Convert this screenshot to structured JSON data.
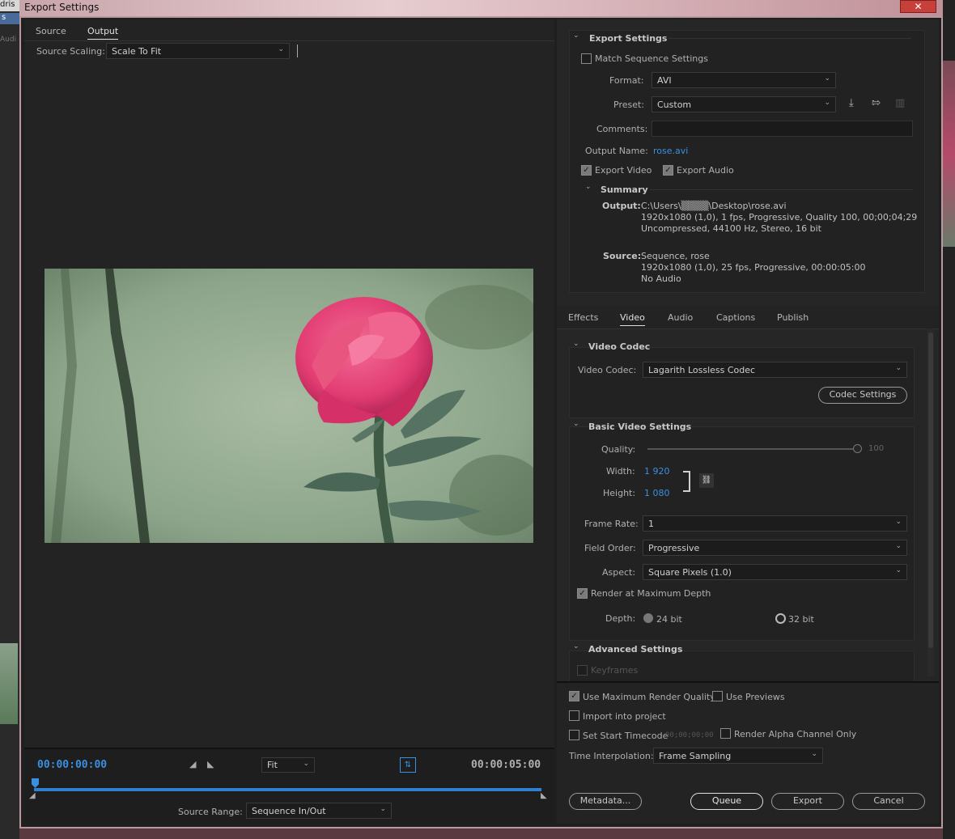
{
  "background": {
    "top_left_1": "dris",
    "top_left_2": "s",
    "side_label": "Audi"
  },
  "window": {
    "title": "Export Settings",
    "close_glyph": "✕"
  },
  "left": {
    "tabs": [
      "Source",
      "Output"
    ],
    "source_scaling_label": "Source Scaling:",
    "source_scaling_value": "Scale To Fit",
    "timecode_start": "00:00:00:00",
    "timecode_end": "00:00:05:00",
    "zoom_value": "Fit",
    "source_range_label": "Source Range:",
    "source_range_value": "Sequence In/Out"
  },
  "export_settings": {
    "header": "Export Settings",
    "match_sequence": "Match Sequence Settings",
    "format_label": "Format:",
    "format_value": "AVI",
    "preset_label": "Preset:",
    "preset_value": "Custom",
    "comments_label": "Comments:",
    "output_name_label": "Output Name:",
    "output_name_value": "rose.avi",
    "export_video": "Export Video",
    "export_audio": "Export Audio",
    "summary_header": "Summary",
    "output_label": "Output:",
    "output_lines": [
      "C:\\Users\\▒▒▒▒\\Desktop\\rose.avi",
      "1920x1080 (1,0), 1 fps, Progressive, Quality 100, 00;00;04;29",
      "Uncompressed, 44100 Hz, Stereo, 16 bit"
    ],
    "source_label": "Source:",
    "source_lines": [
      "Sequence, rose",
      "1920x1080 (1,0), 25 fps, Progressive, 00:00:05:00",
      "No Audio"
    ]
  },
  "tabs": {
    "items": [
      "Effects",
      "Video",
      "Audio",
      "Captions",
      "Publish"
    ],
    "active": "Video"
  },
  "video_codec": {
    "header": "Video Codec",
    "label": "Video Codec:",
    "value": "Lagarith Lossless Codec",
    "settings_button": "Codec Settings"
  },
  "basic_video": {
    "header": "Basic Video Settings",
    "quality_label": "Quality:",
    "quality_value": "100",
    "width_label": "Width:",
    "width_value": "1 920",
    "height_label": "Height:",
    "height_value": "1 080",
    "frame_rate_label": "Frame Rate:",
    "frame_rate_value": "1",
    "field_order_label": "Field Order:",
    "field_order_value": "Progressive",
    "aspect_label": "Aspect:",
    "aspect_value": "Square Pixels (1.0)",
    "render_max_depth": "Render at Maximum Depth",
    "depth_label": "Depth:",
    "depth_24": "24 bit",
    "depth_32": "32 bit"
  },
  "advanced": {
    "header": "Advanced Settings",
    "keyframes": "Keyframes"
  },
  "bottom": {
    "use_max_render": "Use Maximum Render Quality",
    "use_previews": "Use Previews",
    "import_project": "Import into project",
    "set_start_tc": "Set Start Timecode",
    "start_tc_value": "00;00;00;00",
    "render_alpha": "Render Alpha Channel Only",
    "time_interp_label": "Time Interpolation:",
    "time_interp_value": "Frame Sampling",
    "metadata_button": "Metadata...",
    "queue_button": "Queue",
    "export_button": "Export",
    "cancel_button": "Cancel"
  }
}
